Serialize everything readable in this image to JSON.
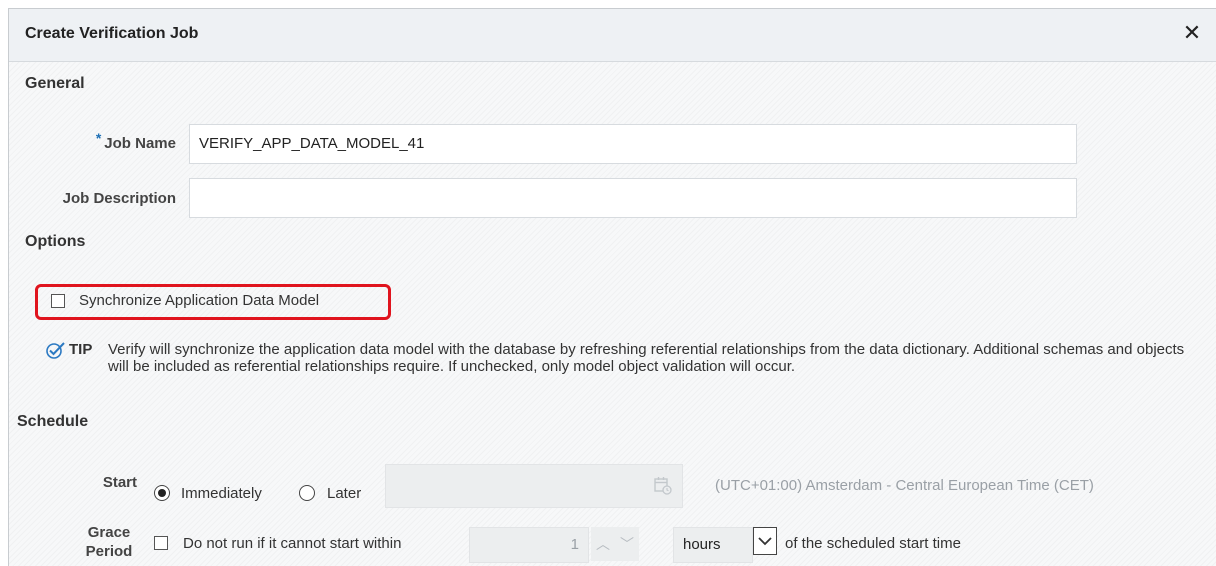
{
  "dialog": {
    "title": "Create Verification Job",
    "close_icon": "close-icon"
  },
  "general": {
    "heading": "General",
    "job_name": {
      "label": "Job Name",
      "required_mark": "*",
      "value": "VERIFY_APP_DATA_MODEL_41"
    },
    "job_description": {
      "label": "Job Description",
      "value": ""
    }
  },
  "options": {
    "heading": "Options",
    "sync_checkbox": {
      "label": "Synchronize Application Data Model",
      "checked": false
    },
    "tip": {
      "icon": "check-circle-icon",
      "label": "TIP",
      "text": "Verify will synchronize the application data model with the database by refreshing referential relationships from the data dictionary. Additional schemas and objects will be included as referential relationships require. If unchecked, only model object validation will occur."
    }
  },
  "schedule": {
    "heading": "Schedule",
    "start": {
      "label": "Start",
      "options": [
        "Immediately",
        "Later"
      ],
      "selected": "Immediately",
      "datetime_value": "",
      "calendar_icon": "calendar-icon",
      "timezone": "(UTC+01:00) Amsterdam - Central European Time (CET)"
    },
    "grace_period": {
      "label_line1": "Grace",
      "label_line2": "Period",
      "checkbox_label": "Do not run if it cannot start within",
      "checked": false,
      "amount": "1",
      "unit": "hours",
      "suffix": "of the scheduled start time"
    }
  }
}
